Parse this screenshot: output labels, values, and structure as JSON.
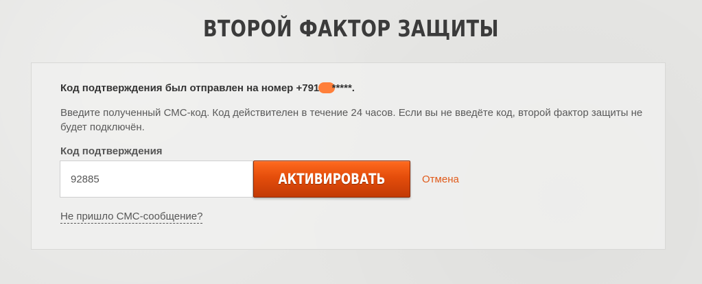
{
  "page": {
    "title": "ВТОРОЙ ФАКТОР ЗАЩИТЫ"
  },
  "panel": {
    "sent_prefix": "Код подтверждения был отправлен на номер +7916",
    "sent_suffix": "*****.",
    "hint": "Введите полученный СМС-код. Код действителен в течение 24 часов. Если вы не введёте код, второй фактор защиты не будет подключён.",
    "code_label": "Код подтверждения",
    "code_value": "92885",
    "activate_label": "АКТИВИРОВАТЬ",
    "cancel_label": "Отмена",
    "no_sms_label": "Не пришло СМС-сообщение?"
  },
  "colors": {
    "accent": "#e44d0b",
    "link": "#e05a1a",
    "redaction": "#ff7f3a"
  }
}
